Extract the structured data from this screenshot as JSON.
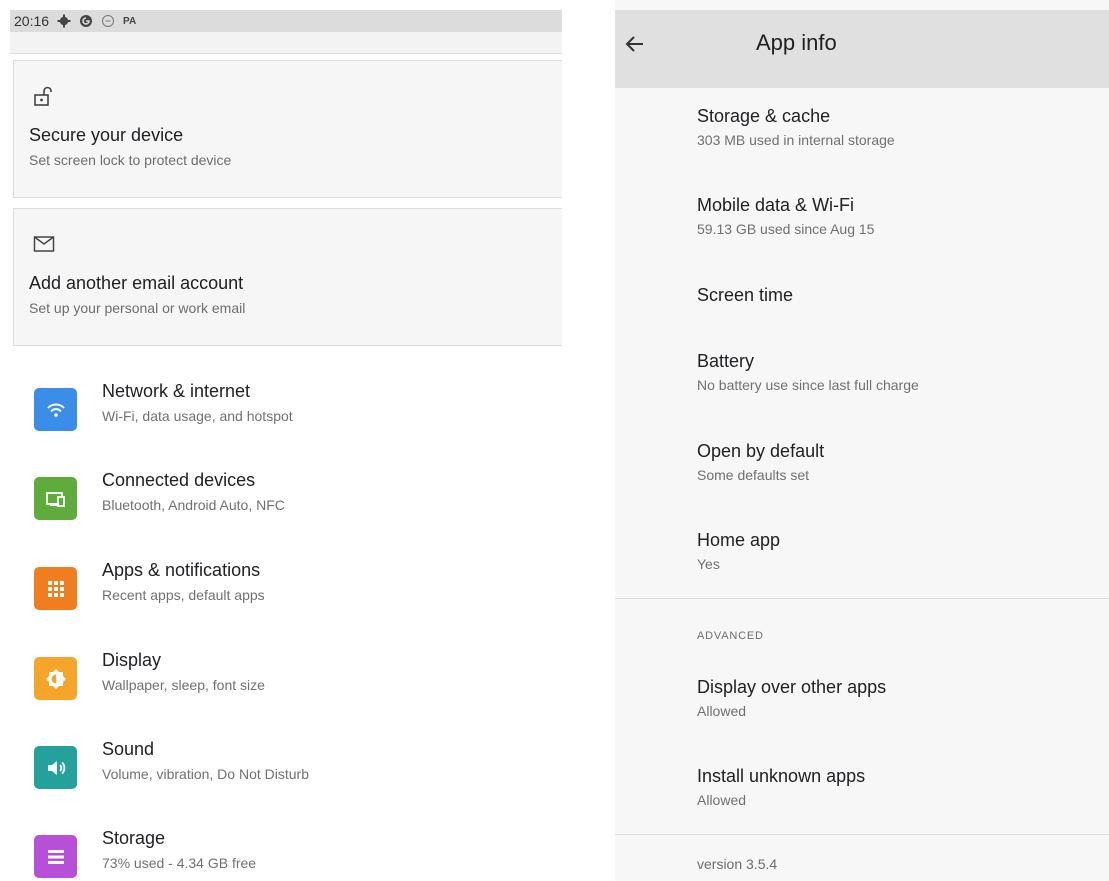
{
  "status_bar": {
    "time": "20:16",
    "carrier_badge": "PA",
    "icons": [
      "gear-icon",
      "circle-g-icon",
      "circle-outline-icon"
    ]
  },
  "suggestions": [
    {
      "icon": "unlock-icon",
      "title": "Secure your device",
      "subtitle": "Set screen lock to protect device"
    },
    {
      "icon": "mail-icon",
      "title": "Add another email account",
      "subtitle": "Set up your personal or work email"
    }
  ],
  "settings": [
    {
      "icon": "wifi-icon",
      "color": "#3b8ee8",
      "title": "Network & internet",
      "subtitle": "Wi-Fi, data usage, and hotspot"
    },
    {
      "icon": "devices-icon",
      "color": "#5fab3c",
      "title": "Connected devices",
      "subtitle": "Bluetooth, Android Auto, NFC"
    },
    {
      "icon": "apps-grid-icon",
      "color": "#f07d1e",
      "title": "Apps & notifications",
      "subtitle": "Recent apps, default apps"
    },
    {
      "icon": "brightness-icon",
      "color": "#f6a52b",
      "title": "Display",
      "subtitle": "Wallpaper, sleep, font size"
    },
    {
      "icon": "volume-icon",
      "color": "#22a29a",
      "title": "Sound",
      "subtitle": "Volume, vibration, Do Not Disturb"
    },
    {
      "icon": "storage-icon",
      "color": "#b74fd9",
      "title": "Storage",
      "subtitle": "73% used - 4.34 GB free"
    }
  ],
  "app_info": {
    "title": "App info",
    "items": [
      {
        "title": "Storage & cache",
        "subtitle": "303 MB used in internal storage"
      },
      {
        "title": "Mobile data & Wi-Fi",
        "subtitle": "59.13 GB used since Aug 15"
      },
      {
        "title": "Screen time",
        "subtitle": ""
      },
      {
        "title": "Battery",
        "subtitle": "No battery use since last full charge"
      },
      {
        "title": "Open by default",
        "subtitle": "Some defaults set"
      },
      {
        "title": "Home app",
        "subtitle": "Yes"
      }
    ],
    "advanced_label": "ADVANCED",
    "advanced_items": [
      {
        "title": "Display over other apps",
        "subtitle": "Allowed"
      },
      {
        "title": "Install unknown apps",
        "subtitle": "Allowed"
      }
    ],
    "version": "version 3.5.4"
  }
}
